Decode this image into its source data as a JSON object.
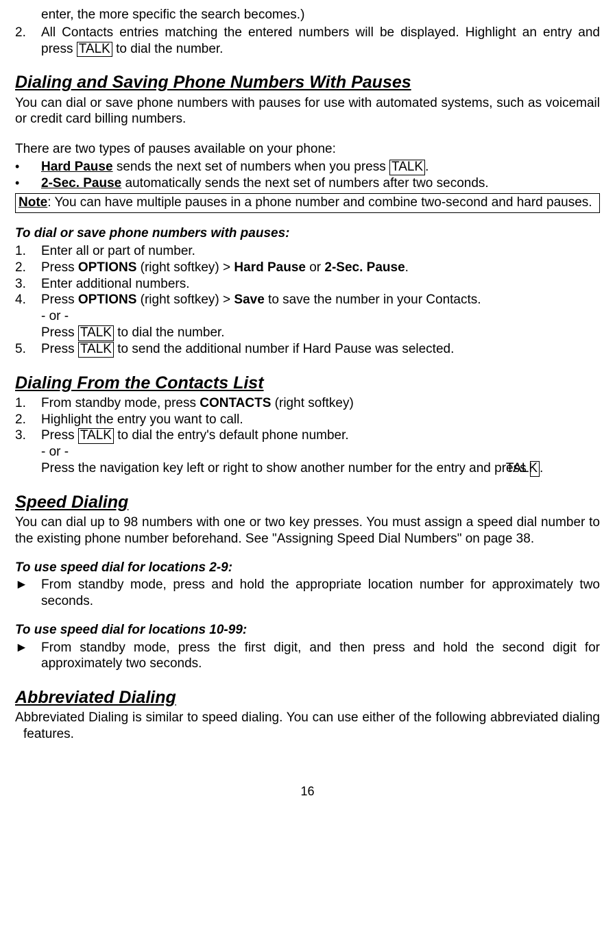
{
  "top": {
    "li1_suffix": "enter, the more specific the search becomes.)",
    "li2_a": "All Contacts entries matching the entered numbers will be displayed. Highlight an entry and press ",
    "li2_key": "TALK",
    "li2_b": " to dial the number."
  },
  "sec1": {
    "title": "Dialing and Saving Phone Numbers With Pauses",
    "p1": "You can dial or save phone numbers with pauses for use with automated systems, such as voicemail or credit card billing numbers.",
    "p2": "There are two types of pauses available on your phone:",
    "b1_label": "Hard Pause",
    "b1_text_a": " sends the next set of numbers when you press ",
    "b1_key": "TALK",
    "b1_text_b": ".",
    "b2_label": "2-Sec. Pause",
    "b2_text": " automatically sends the next set of numbers after two seconds.",
    "note_label": "Note",
    "note_text": ": You can have multiple pauses in a phone number and combine two-second and hard pauses.",
    "sub1_title": "To dial or save phone numbers with pauses:",
    "s1_li1": "Enter all or part of number.",
    "s1_li2_a": "Press ",
    "s1_li2_opt": "OPTIONS",
    "s1_li2_b": " (right softkey) > ",
    "s1_li2_hp": "Hard Pause",
    "s1_li2_or": " or ",
    "s1_li2_sp": "2-Sec. Pause",
    "s1_li2_c": ".",
    "s1_li3": "Enter additional numbers.",
    "s1_li4_a": "Press ",
    "s1_li4_opt": "OPTIONS",
    "s1_li4_b": " (right softkey) > ",
    "s1_li4_save": "Save",
    "s1_li4_c": " to save the number in your Contacts.",
    "s1_li4_or": "- or -",
    "s1_li4_d": "Press ",
    "s1_li4_key": "TALK",
    "s1_li4_e": " to dial the number.",
    "s1_li5_a": "Press ",
    "s1_li5_key": "TALK",
    "s1_li5_b": " to send the additional number if Hard Pause was selected."
  },
  "sec2": {
    "title": "Dialing From the Contacts List",
    "li1_a": "From standby mode, press ",
    "li1_b": "CONTACTS",
    "li1_c": " (right softkey)",
    "li2": "Highlight the entry you want to call.",
    "li3_a": "Press ",
    "li3_key": "TALK",
    "li3_b": " to dial the entry's default phone number.",
    "li3_or": "- or -",
    "li3_c": "Press the navigation key left or right to show another number for the entry and press ",
    "li3_key2": "TALK",
    "li3_d": "."
  },
  "sec3": {
    "title": "Speed Dialing",
    "p1": "You can dial up to 98 numbers with one or two key presses. You must assign a speed dial number to the existing phone number beforehand. See \"Assigning Speed Dial Numbers\" on page 38.",
    "sub1": "To use speed dial for locations 2-9:",
    "sub1_li": "From standby mode, press and hold the appropriate location number for approximately two seconds.",
    "sub2": "To use speed dial for locations 10-99:",
    "sub2_li": "From standby mode, press the first digit, and then press and hold the second digit for approximately two seconds."
  },
  "sec4": {
    "title": "Abbreviated Dialing",
    "p1": "Abbreviated Dialing is similar to speed dialing. You can use either of the following abbreviated dialing features."
  },
  "page_number": "16",
  "labels": {
    "n1": "1.",
    "n2": "2.",
    "n3": "3.",
    "n4": "4.",
    "n5": "5.",
    "bullet": "•",
    "arrow": "►"
  }
}
